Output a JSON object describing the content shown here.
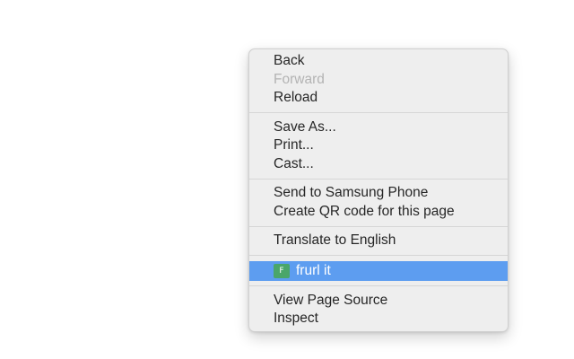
{
  "context_menu": {
    "groups": [
      {
        "items": [
          {
            "label": "Back",
            "enabled": true
          },
          {
            "label": "Forward",
            "enabled": false
          },
          {
            "label": "Reload",
            "enabled": true
          }
        ]
      },
      {
        "items": [
          {
            "label": "Save As...",
            "enabled": true
          },
          {
            "label": "Print...",
            "enabled": true
          },
          {
            "label": "Cast...",
            "enabled": true
          }
        ]
      },
      {
        "items": [
          {
            "label": "Send to Samsung Phone",
            "enabled": true
          },
          {
            "label": "Create QR code for this page",
            "enabled": true
          }
        ]
      },
      {
        "items": [
          {
            "label": "Translate to English",
            "enabled": true
          }
        ]
      },
      {
        "items": [
          {
            "label": "frurl it",
            "enabled": true,
            "highlighted": true,
            "icon": {
              "name": "frurl-extension-icon",
              "letter": "F",
              "color": "#4aa66a"
            }
          }
        ]
      },
      {
        "items": [
          {
            "label": "View Page Source",
            "enabled": true
          },
          {
            "label": "Inspect",
            "enabled": true
          }
        ]
      }
    ],
    "highlight_color": "#5d9df0"
  }
}
